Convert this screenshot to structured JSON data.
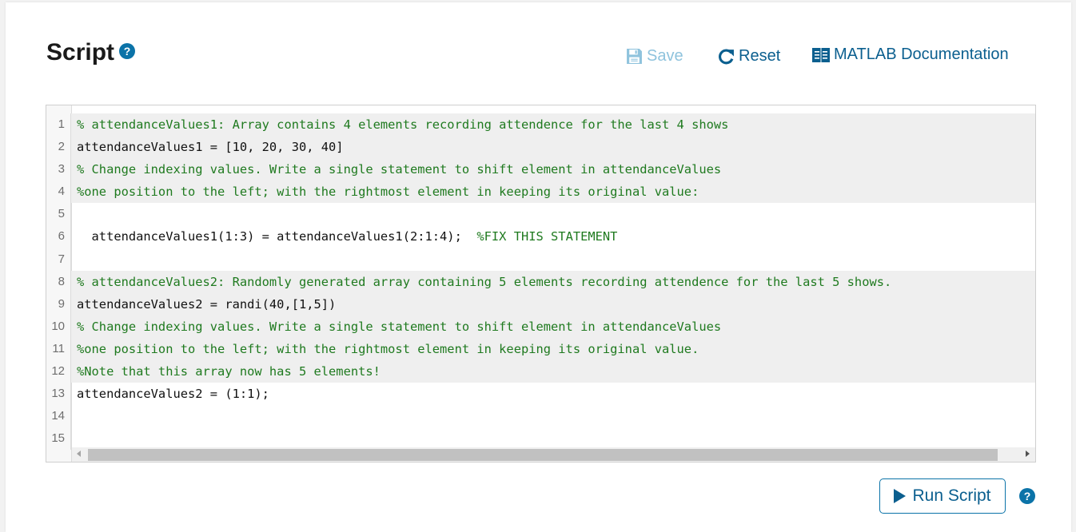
{
  "header": {
    "title": "Script",
    "help_icon": "question-circle-icon"
  },
  "toolbar": {
    "save_label": "Save",
    "save_icon": "floppy-disk-icon",
    "save_enabled": false,
    "reset_label": "Reset",
    "reset_icon": "refresh-icon",
    "doc_label": "MATLAB Documentation",
    "doc_icon": "book-icon"
  },
  "editor": {
    "current_line": 13,
    "lines": [
      {
        "num": "1",
        "type": "comment",
        "readonly": true,
        "text": "% attendanceValues1: Array contains 4 elements recording attendence for the last 4 shows"
      },
      {
        "num": "2",
        "type": "code",
        "readonly": true,
        "text": "attendanceValues1 = [10, 20, 30, 40]"
      },
      {
        "num": "3",
        "type": "comment",
        "readonly": true,
        "text": "% Change indexing values. Write a single statement to shift element in attendanceValues"
      },
      {
        "num": "4",
        "type": "comment",
        "readonly": true,
        "text": "%one position to the left; with the rightmost element in keeping its original value:"
      },
      {
        "num": "5",
        "type": "code",
        "readonly": false,
        "text": ""
      },
      {
        "num": "6",
        "type": "mixed",
        "readonly": false,
        "text": "  attendanceValues1(1:3) = attendanceValues1(2:1:4);  ",
        "comment": "%FIX THIS STATEMENT"
      },
      {
        "num": "7",
        "type": "code",
        "readonly": false,
        "text": ""
      },
      {
        "num": "8",
        "type": "comment",
        "readonly": true,
        "text": "% attendanceValues2: Randomly generated array containing 5 elements recording attendence for the last 5 shows."
      },
      {
        "num": "9",
        "type": "code",
        "readonly": true,
        "text": "attendanceValues2 = randi(40,[1,5])"
      },
      {
        "num": "10",
        "type": "comment",
        "readonly": true,
        "text": "% Change indexing values. Write a single statement to shift element in attendanceValues"
      },
      {
        "num": "11",
        "type": "comment",
        "readonly": true,
        "text": "%one position to the left; with the rightmost element in keeping its original value."
      },
      {
        "num": "12",
        "type": "comment",
        "readonly": true,
        "text": "%Note that this array now has 5 elements!"
      },
      {
        "num": "13",
        "type": "code",
        "readonly": false,
        "text": "attendanceValues2 = (1:1);"
      },
      {
        "num": "14",
        "type": "code",
        "readonly": false,
        "text": ""
      },
      {
        "num": "15",
        "type": "code",
        "readonly": false,
        "text": ""
      }
    ]
  },
  "footer": {
    "run_label": "Run Script",
    "run_icon": "play-icon",
    "help_icon": "question-circle-icon"
  },
  "colors": {
    "accent": "#0b73a8",
    "link": "#0b5f8f",
    "disabled": "#8fc3dd",
    "comment": "#1f7a1f",
    "readonly_bg": "#efefef"
  }
}
